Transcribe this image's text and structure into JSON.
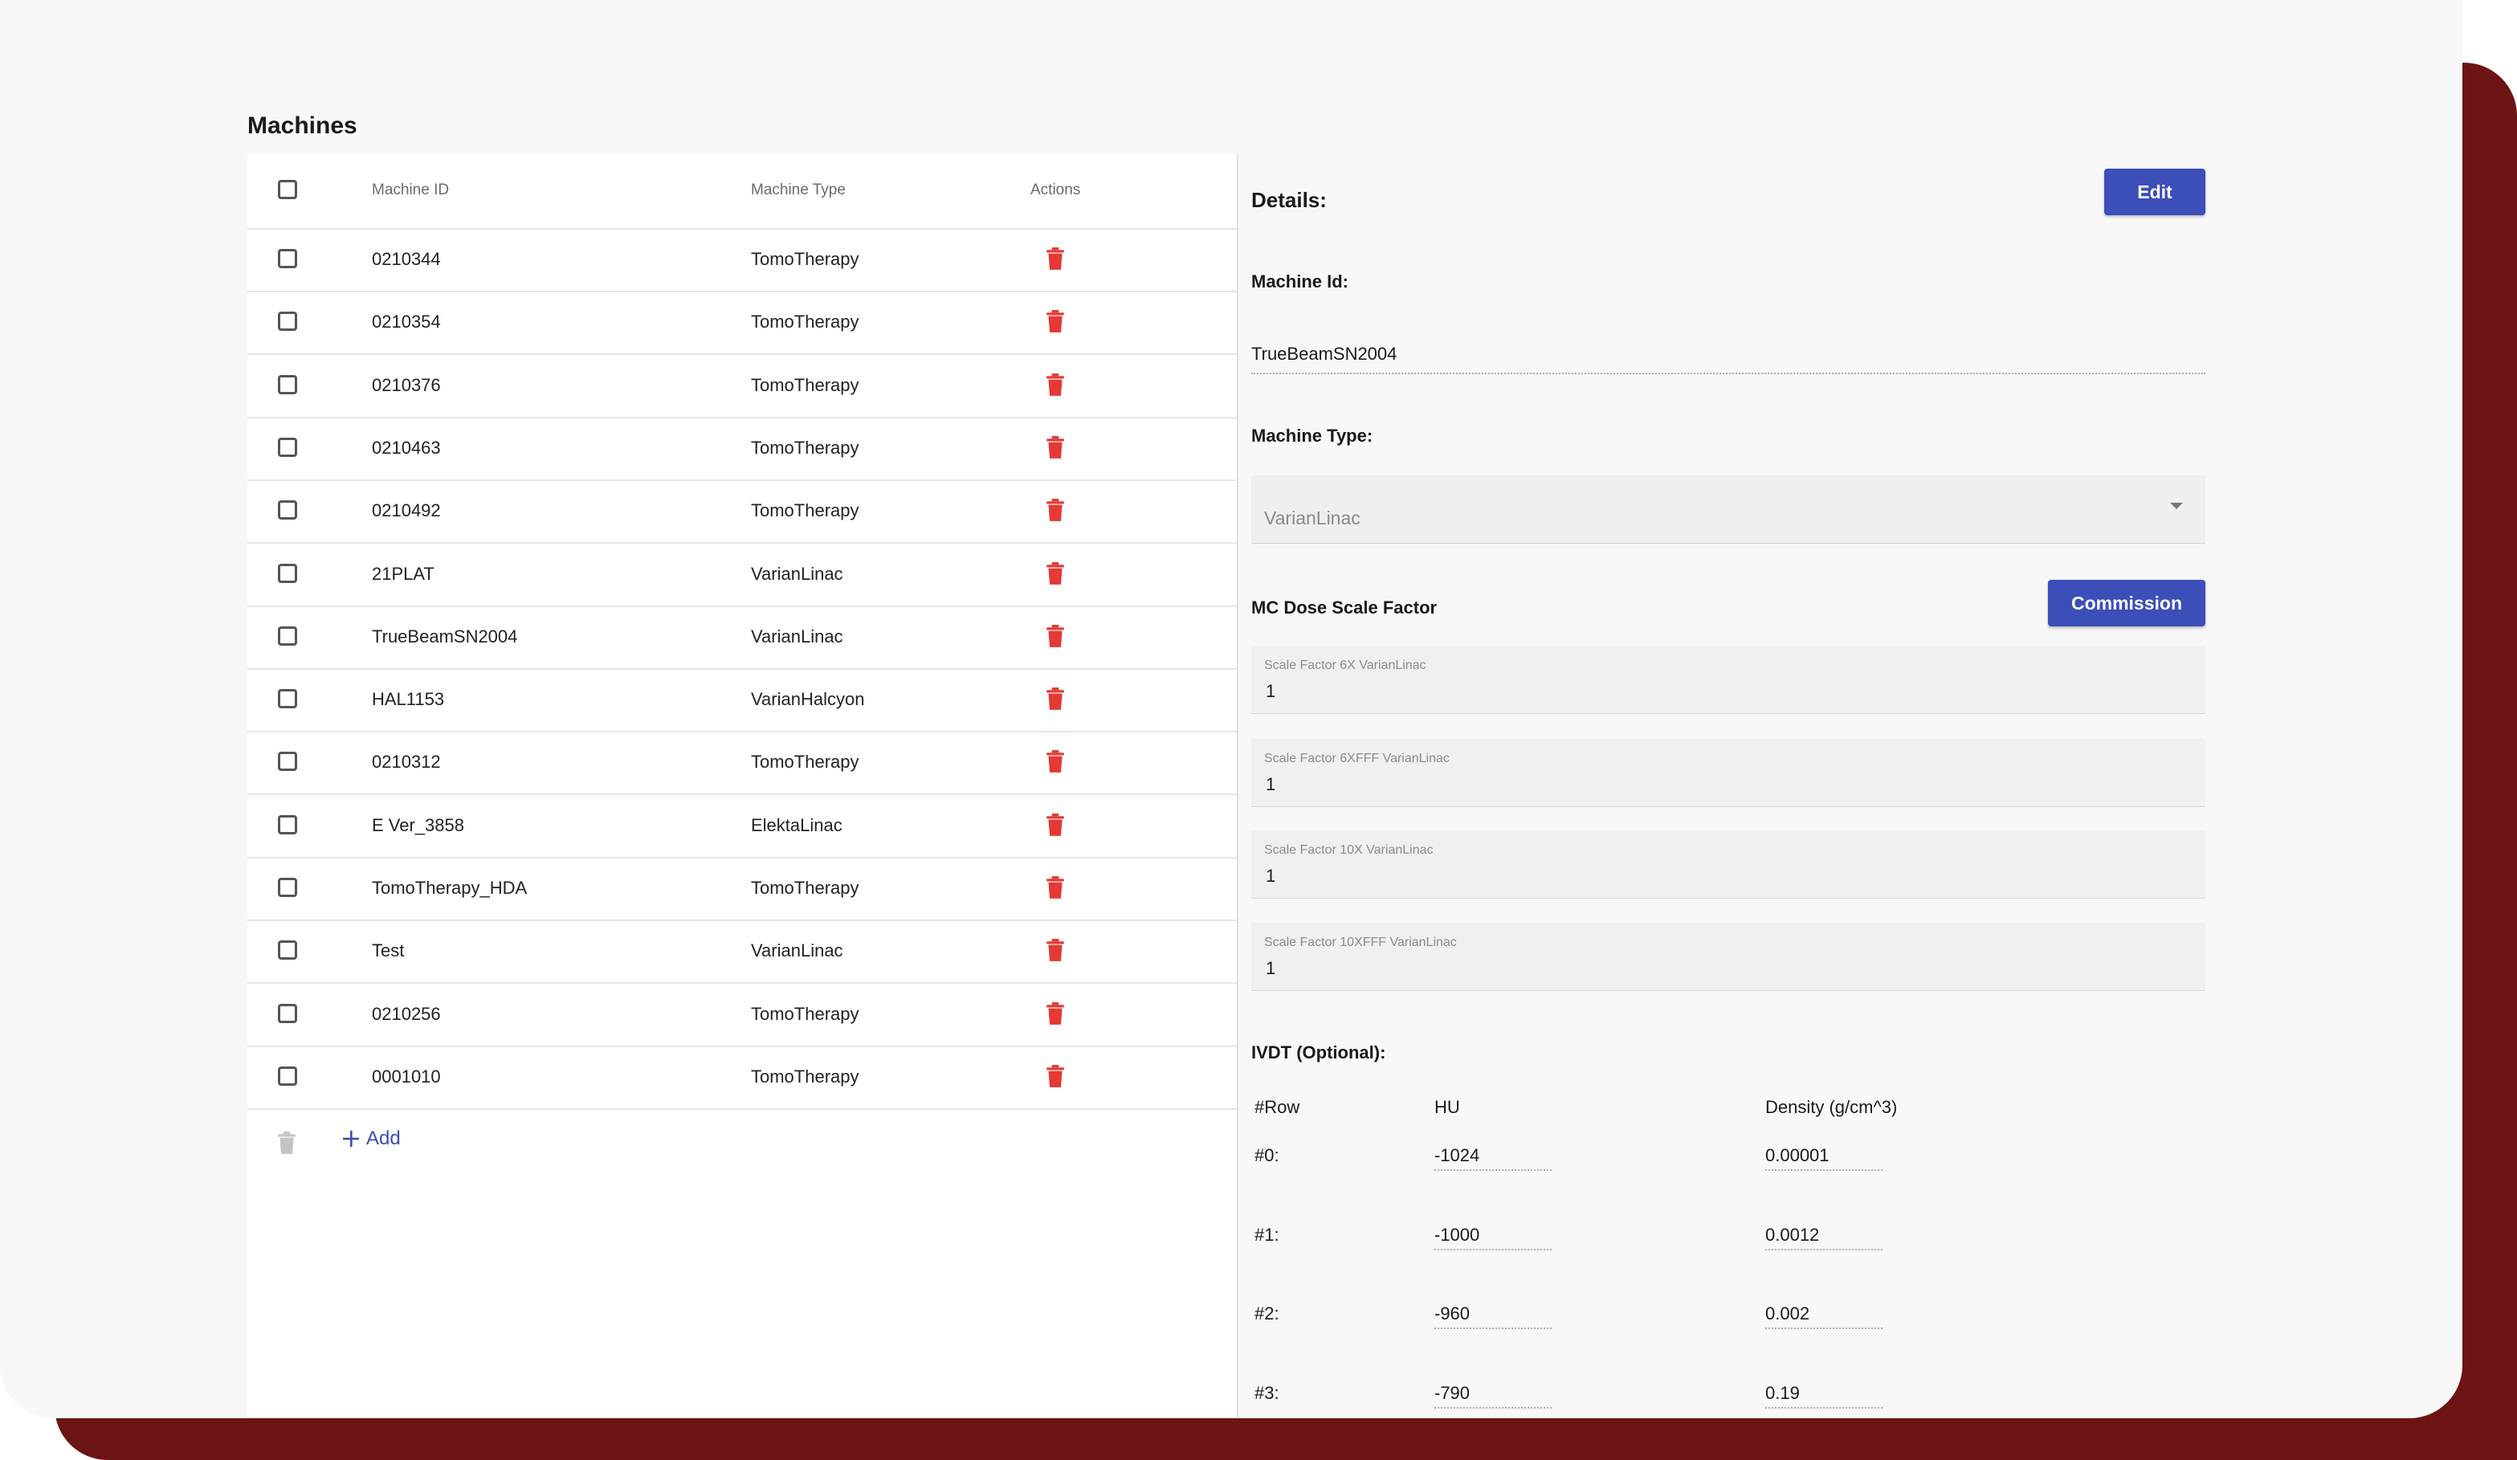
{
  "page": {
    "title": "Machines"
  },
  "table": {
    "columns": [
      "Machine ID",
      "Machine Type",
      "Actions"
    ],
    "rows": [
      {
        "id": "0210344",
        "type": "TomoTherapy"
      },
      {
        "id": "0210354",
        "type": "TomoTherapy"
      },
      {
        "id": "0210376",
        "type": "TomoTherapy"
      },
      {
        "id": "0210463",
        "type": "TomoTherapy"
      },
      {
        "id": "0210492",
        "type": "TomoTherapy"
      },
      {
        "id": "21PLAT",
        "type": "VarianLinac"
      },
      {
        "id": "TrueBeamSN2004",
        "type": "VarianLinac"
      },
      {
        "id": "HAL1153",
        "type": "VarianHalcyon"
      },
      {
        "id": "0210312",
        "type": "TomoTherapy"
      },
      {
        "id": "E Ver_3858",
        "type": "ElektaLinac"
      },
      {
        "id": "TomoTherapy_HDA",
        "type": "TomoTherapy"
      },
      {
        "id": "Test",
        "type": "VarianLinac"
      },
      {
        "id": "0210256",
        "type": "TomoTherapy"
      },
      {
        "id": "0001010",
        "type": "TomoTherapy"
      }
    ],
    "add_label": "Add",
    "delete_icon_color": "#e53935",
    "delete_disabled_color": "#bdbdbd"
  },
  "details": {
    "title": "Details:",
    "edit_label": "Edit",
    "machine_id_label": "Machine Id:",
    "machine_id_value": "TrueBeamSN2004",
    "machine_type_label": "Machine Type:",
    "machine_type_value": "VarianLinac",
    "mc_label": "MC Dose Scale Factor",
    "commission_label": "Commission",
    "scale_factors": [
      {
        "label": "Scale Factor 6X VarianLinac",
        "value": "1"
      },
      {
        "label": "Scale Factor 6XFFF VarianLinac",
        "value": "1"
      },
      {
        "label": "Scale Factor 10X VarianLinac",
        "value": "1"
      },
      {
        "label": "Scale Factor 10XFFF VarianLinac",
        "value": "1"
      }
    ],
    "ivdt_label": "IVDT (Optional):",
    "ivdt_headers": [
      "#Row",
      "HU",
      "Density (g/cm^3)"
    ],
    "ivdt_rows": [
      {
        "row": "#0:",
        "hu": "-1024",
        "density": "0.00001"
      },
      {
        "row": "#1:",
        "hu": "-1000",
        "density": "0.0012"
      },
      {
        "row": "#2:",
        "hu": "-960",
        "density": "0.002"
      },
      {
        "row": "#3:",
        "hu": "-790",
        "density": "0.19"
      }
    ]
  },
  "colors": {
    "accent": "#3c4eb8",
    "frame": "#6d1414",
    "background": "#f8f8f9"
  }
}
